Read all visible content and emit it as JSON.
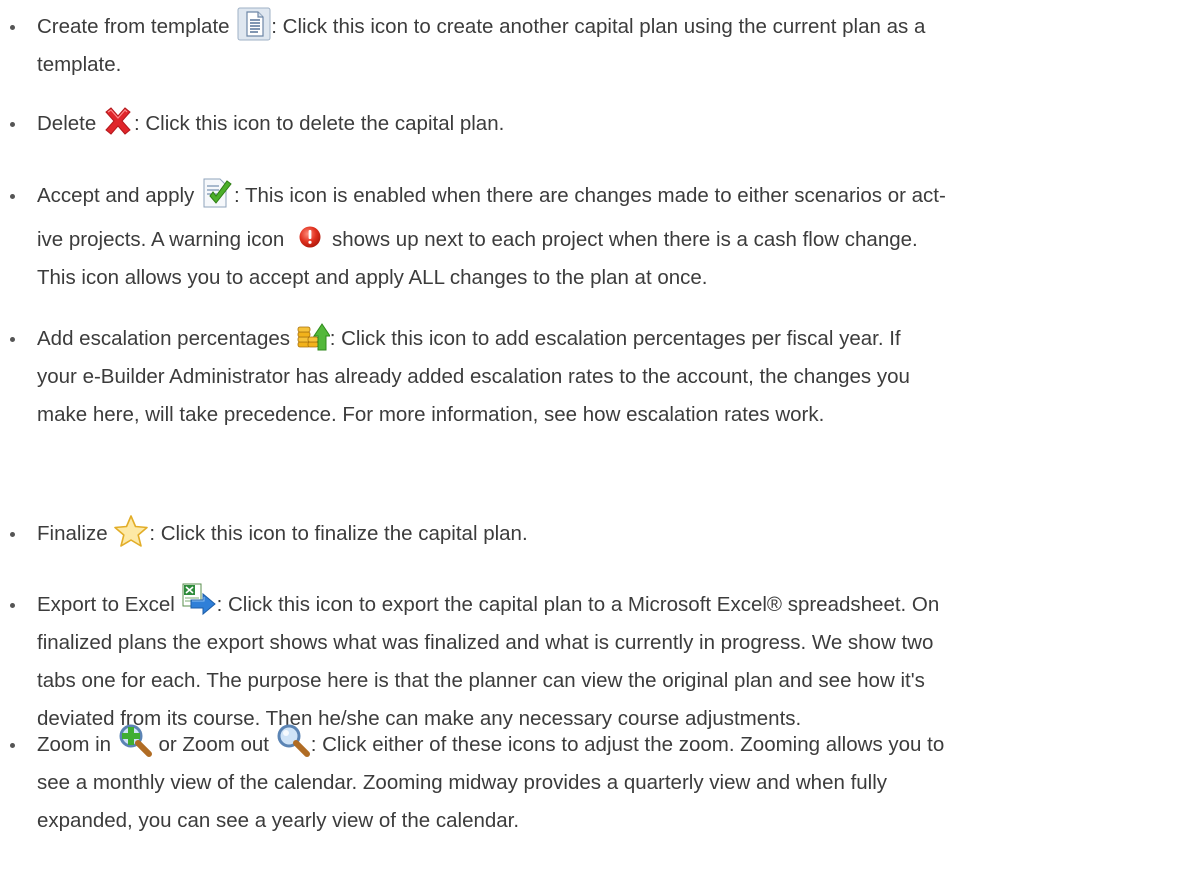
{
  "items": [
    {
      "label": "Create from template",
      "icon": "template-document-icon",
      "lines": [
        ": Click this icon to create another capital plan using the current plan as a",
        "template."
      ]
    },
    {
      "label": "Delete",
      "icon": "delete-x-icon",
      "lines": [
        ": Click this icon to delete the capital plan."
      ]
    },
    {
      "label": "Accept and apply",
      "icon": "accept-apply-checkmark-icon",
      "lines": [
        ": This icon is enabled when there are changes made to either scenarios or act-",
        "ive projects. A warning icon",
        "shows up next to each project when there is a cash flow change.",
        "This icon allows you to accept and apply ALL changes to the plan at once."
      ],
      "inline_icon": "warning-icon"
    },
    {
      "label": "Add escalation percentages",
      "icon": "escalation-coins-arrow-icon",
      "lines": [
        ": Click this icon to add escalation percentages per fiscal year. If",
        "your e-Builder Administrator has already added escalation rates to the account, the changes you",
        "make here, will take precedence. For more information, see how escalation rates work."
      ]
    },
    {
      "label": "Finalize",
      "icon": "finalize-star-icon",
      "lines": [
        ": Click this icon to finalize the capital plan."
      ]
    },
    {
      "label": "Export to Excel",
      "icon": "excel-export-icon",
      "lines": [
        ": Click this icon to export the capital plan to a Microsoft Excel® spreadsheet. On",
        "finalized plans the export shows what was finalized and what is currently in progress. We show two",
        "tabs one for each. The purpose here is that the planner can view the original plan and see how it's",
        "deviated from its course. Then he/she can make any necessary course adjustments."
      ]
    },
    {
      "label": "Zoom in",
      "label2": "or Zoom out",
      "icon": "zoom-in-icon",
      "icon2": "zoom-out-icon",
      "lines": [
        ": Click either of these icons to adjust the zoom. Zooming allows you to",
        "see a monthly view of the calendar. Zooming midway provides a quarterly view and when fully",
        "expanded, you can see a yearly view of the calendar."
      ]
    }
  ]
}
